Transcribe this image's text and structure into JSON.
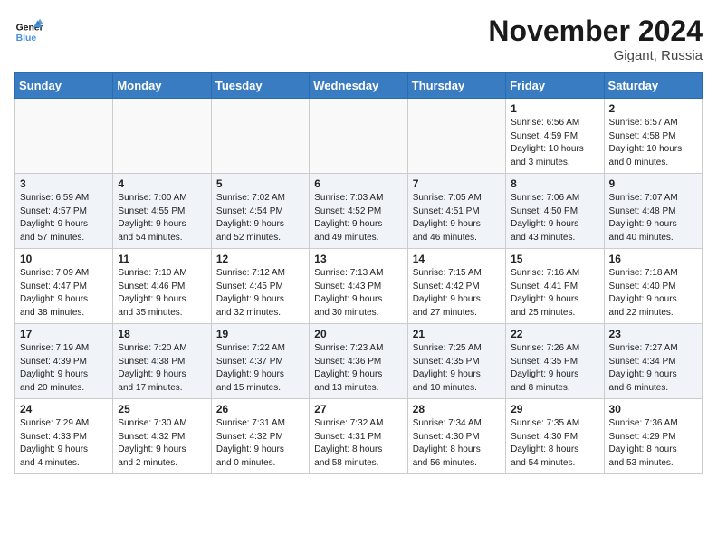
{
  "header": {
    "logo_line1": "General",
    "logo_line2": "Blue",
    "month_title": "November 2024",
    "location": "Gigant, Russia"
  },
  "days_of_week": [
    "Sunday",
    "Monday",
    "Tuesday",
    "Wednesday",
    "Thursday",
    "Friday",
    "Saturday"
  ],
  "weeks": [
    [
      {
        "day": "",
        "info": ""
      },
      {
        "day": "",
        "info": ""
      },
      {
        "day": "",
        "info": ""
      },
      {
        "day": "",
        "info": ""
      },
      {
        "day": "",
        "info": ""
      },
      {
        "day": "1",
        "info": "Sunrise: 6:56 AM\nSunset: 4:59 PM\nDaylight: 10 hours\nand 3 minutes."
      },
      {
        "day": "2",
        "info": "Sunrise: 6:57 AM\nSunset: 4:58 PM\nDaylight: 10 hours\nand 0 minutes."
      }
    ],
    [
      {
        "day": "3",
        "info": "Sunrise: 6:59 AM\nSunset: 4:57 PM\nDaylight: 9 hours\nand 57 minutes."
      },
      {
        "day": "4",
        "info": "Sunrise: 7:00 AM\nSunset: 4:55 PM\nDaylight: 9 hours\nand 54 minutes."
      },
      {
        "day": "5",
        "info": "Sunrise: 7:02 AM\nSunset: 4:54 PM\nDaylight: 9 hours\nand 52 minutes."
      },
      {
        "day": "6",
        "info": "Sunrise: 7:03 AM\nSunset: 4:52 PM\nDaylight: 9 hours\nand 49 minutes."
      },
      {
        "day": "7",
        "info": "Sunrise: 7:05 AM\nSunset: 4:51 PM\nDaylight: 9 hours\nand 46 minutes."
      },
      {
        "day": "8",
        "info": "Sunrise: 7:06 AM\nSunset: 4:50 PM\nDaylight: 9 hours\nand 43 minutes."
      },
      {
        "day": "9",
        "info": "Sunrise: 7:07 AM\nSunset: 4:48 PM\nDaylight: 9 hours\nand 40 minutes."
      }
    ],
    [
      {
        "day": "10",
        "info": "Sunrise: 7:09 AM\nSunset: 4:47 PM\nDaylight: 9 hours\nand 38 minutes."
      },
      {
        "day": "11",
        "info": "Sunrise: 7:10 AM\nSunset: 4:46 PM\nDaylight: 9 hours\nand 35 minutes."
      },
      {
        "day": "12",
        "info": "Sunrise: 7:12 AM\nSunset: 4:45 PM\nDaylight: 9 hours\nand 32 minutes."
      },
      {
        "day": "13",
        "info": "Sunrise: 7:13 AM\nSunset: 4:43 PM\nDaylight: 9 hours\nand 30 minutes."
      },
      {
        "day": "14",
        "info": "Sunrise: 7:15 AM\nSunset: 4:42 PM\nDaylight: 9 hours\nand 27 minutes."
      },
      {
        "day": "15",
        "info": "Sunrise: 7:16 AM\nSunset: 4:41 PM\nDaylight: 9 hours\nand 25 minutes."
      },
      {
        "day": "16",
        "info": "Sunrise: 7:18 AM\nSunset: 4:40 PM\nDaylight: 9 hours\nand 22 minutes."
      }
    ],
    [
      {
        "day": "17",
        "info": "Sunrise: 7:19 AM\nSunset: 4:39 PM\nDaylight: 9 hours\nand 20 minutes."
      },
      {
        "day": "18",
        "info": "Sunrise: 7:20 AM\nSunset: 4:38 PM\nDaylight: 9 hours\nand 17 minutes."
      },
      {
        "day": "19",
        "info": "Sunrise: 7:22 AM\nSunset: 4:37 PM\nDaylight: 9 hours\nand 15 minutes."
      },
      {
        "day": "20",
        "info": "Sunrise: 7:23 AM\nSunset: 4:36 PM\nDaylight: 9 hours\nand 13 minutes."
      },
      {
        "day": "21",
        "info": "Sunrise: 7:25 AM\nSunset: 4:35 PM\nDaylight: 9 hours\nand 10 minutes."
      },
      {
        "day": "22",
        "info": "Sunrise: 7:26 AM\nSunset: 4:35 PM\nDaylight: 9 hours\nand 8 minutes."
      },
      {
        "day": "23",
        "info": "Sunrise: 7:27 AM\nSunset: 4:34 PM\nDaylight: 9 hours\nand 6 minutes."
      }
    ],
    [
      {
        "day": "24",
        "info": "Sunrise: 7:29 AM\nSunset: 4:33 PM\nDaylight: 9 hours\nand 4 minutes."
      },
      {
        "day": "25",
        "info": "Sunrise: 7:30 AM\nSunset: 4:32 PM\nDaylight: 9 hours\nand 2 minutes."
      },
      {
        "day": "26",
        "info": "Sunrise: 7:31 AM\nSunset: 4:32 PM\nDaylight: 9 hours\nand 0 minutes."
      },
      {
        "day": "27",
        "info": "Sunrise: 7:32 AM\nSunset: 4:31 PM\nDaylight: 8 hours\nand 58 minutes."
      },
      {
        "day": "28",
        "info": "Sunrise: 7:34 AM\nSunset: 4:30 PM\nDaylight: 8 hours\nand 56 minutes."
      },
      {
        "day": "29",
        "info": "Sunrise: 7:35 AM\nSunset: 4:30 PM\nDaylight: 8 hours\nand 54 minutes."
      },
      {
        "day": "30",
        "info": "Sunrise: 7:36 AM\nSunset: 4:29 PM\nDaylight: 8 hours\nand 53 minutes."
      }
    ]
  ]
}
